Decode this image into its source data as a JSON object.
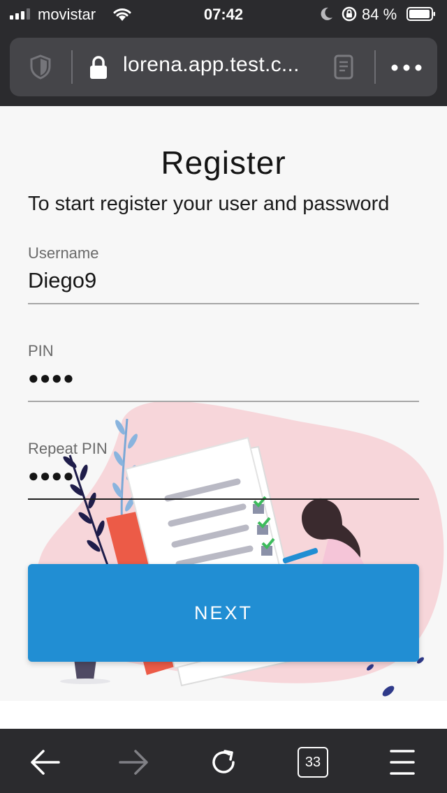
{
  "status_bar": {
    "carrier": "movistar",
    "time": "07:42",
    "battery_percent": "84 %",
    "signal_bars": 3,
    "signal_bars_total": 4
  },
  "browser": {
    "url": "lorena.app.test.c..."
  },
  "page": {
    "title": "Register",
    "subtitle": "To start register your user and password",
    "fields": [
      {
        "label": "Username",
        "value": "Diego9"
      },
      {
        "label": "PIN",
        "value": "●●●●"
      },
      {
        "label": "Repeat PIN",
        "value": "●●●●"
      }
    ],
    "next_button": "NEXT"
  },
  "toolbar": {
    "tab_count": "33"
  },
  "colors": {
    "primary": "#218ed3",
    "illustration_blob": "#f7d6da",
    "illustration_accent": "#ec5b47"
  }
}
